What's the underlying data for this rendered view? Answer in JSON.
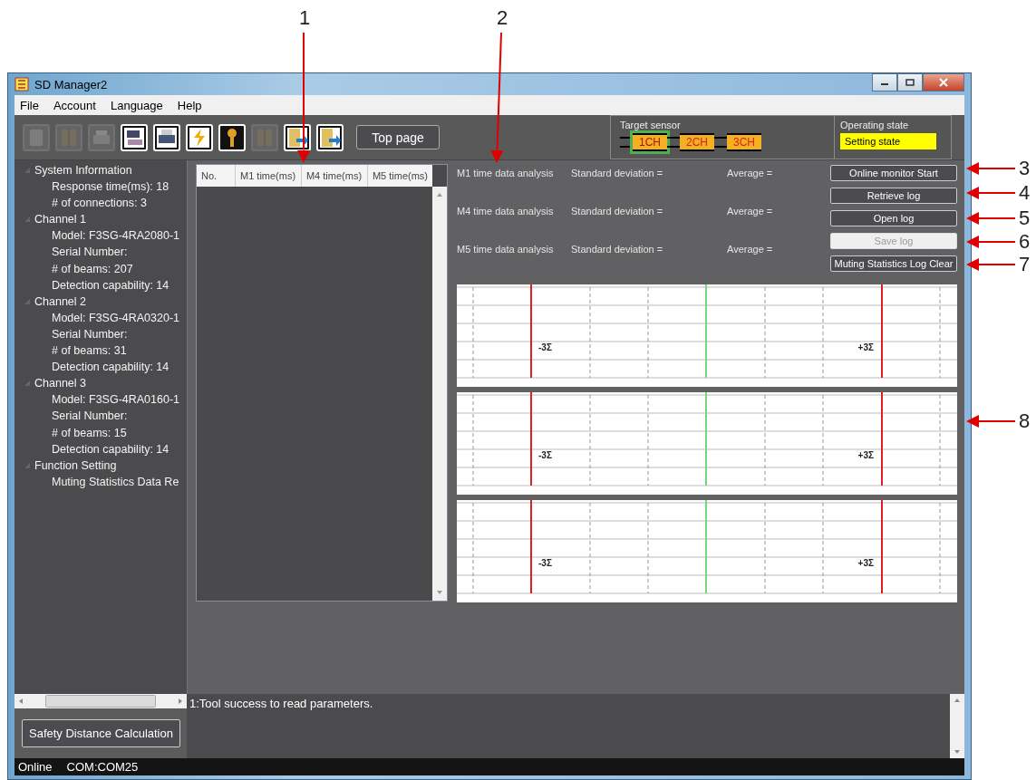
{
  "window": {
    "title": "SD Manager2"
  },
  "menu": [
    "File",
    "Account",
    "Language",
    "Help"
  ],
  "toolbar": {
    "icons": [
      {
        "disabled": true
      },
      {
        "disabled": true
      },
      {
        "disabled": true
      },
      {
        "disabled": false
      },
      {
        "disabled": false
      },
      {
        "disabled": false
      },
      {
        "disabled": false
      },
      {
        "disabled": true
      },
      {
        "disabled": false
      },
      {
        "disabled": false
      }
    ],
    "top_page_button": "Top page"
  },
  "target_sensor": {
    "label": "Target sensor",
    "channels": [
      {
        "label": "1CH",
        "selected": true
      },
      {
        "label": "2CH",
        "selected": false
      },
      {
        "label": "3CH",
        "selected": false
      }
    ]
  },
  "operating_state": {
    "label": "Operating state",
    "value": "Setting state"
  },
  "tree": [
    {
      "label": "System Information",
      "children": [
        {
          "label": "Response time(ms): 18"
        },
        {
          "label": "# of connections: 3"
        }
      ]
    },
    {
      "label": "Channel 1",
      "children": [
        {
          "label": "Model: F3SG-4RA2080-1"
        },
        {
          "label": "Serial Number:"
        },
        {
          "label": "# of beams: 207"
        },
        {
          "label": "Detection capability: 14"
        }
      ]
    },
    {
      "label": "Channel 2",
      "children": [
        {
          "label": "Model: F3SG-4RA0320-1"
        },
        {
          "label": "Serial Number:"
        },
        {
          "label": "# of beams: 31"
        },
        {
          "label": "Detection capability: 14"
        }
      ]
    },
    {
      "label": "Channel 3",
      "children": [
        {
          "label": "Model: F3SG-4RA0160-1"
        },
        {
          "label": "Serial Number:"
        },
        {
          "label": "# of beams: 15"
        },
        {
          "label": "Detection capability: 14"
        }
      ]
    },
    {
      "label": "Function Setting",
      "children": [
        {
          "label": "Muting Statistics Data Re"
        }
      ]
    }
  ],
  "safety_button": "Safety Distance Calculation",
  "table": {
    "columns": [
      "No.",
      "M1 time(ms)",
      "M4 time(ms)",
      "M5 time(ms)"
    ]
  },
  "analysis": [
    {
      "label": "M1 time data analysis",
      "std": "Standard deviation =",
      "avg": "Average ="
    },
    {
      "label": "M4 time data analysis",
      "std": "Standard deviation =",
      "avg": "Average ="
    },
    {
      "label": "M5 time data analysis",
      "std": "Standard deviation =",
      "avg": "Average ="
    }
  ],
  "buttons": [
    {
      "label": "Online monitor Start",
      "disabled": false
    },
    {
      "label": "Retrieve log",
      "disabled": false
    },
    {
      "label": "Open log",
      "disabled": false
    },
    {
      "label": "Save log",
      "disabled": true
    },
    {
      "label": "Muting Statistics Log Clear",
      "disabled": false
    }
  ],
  "charts": [
    {
      "lower_label": "-3Σ",
      "upper_label": "+3Σ"
    },
    {
      "lower_label": "-3Σ",
      "upper_label": "+3Σ"
    },
    {
      "lower_label": "-3Σ",
      "upper_label": "+3Σ"
    }
  ],
  "log": [
    "1:Tool success to read parameters."
  ],
  "status_bar": [
    "Online",
    "COM:COM25"
  ],
  "callouts": [
    {
      "label": "1"
    },
    {
      "label": "2"
    },
    {
      "label": "3"
    },
    {
      "label": "4"
    },
    {
      "label": "5"
    },
    {
      "label": "6"
    },
    {
      "label": "7"
    },
    {
      "label": "8"
    }
  ]
}
